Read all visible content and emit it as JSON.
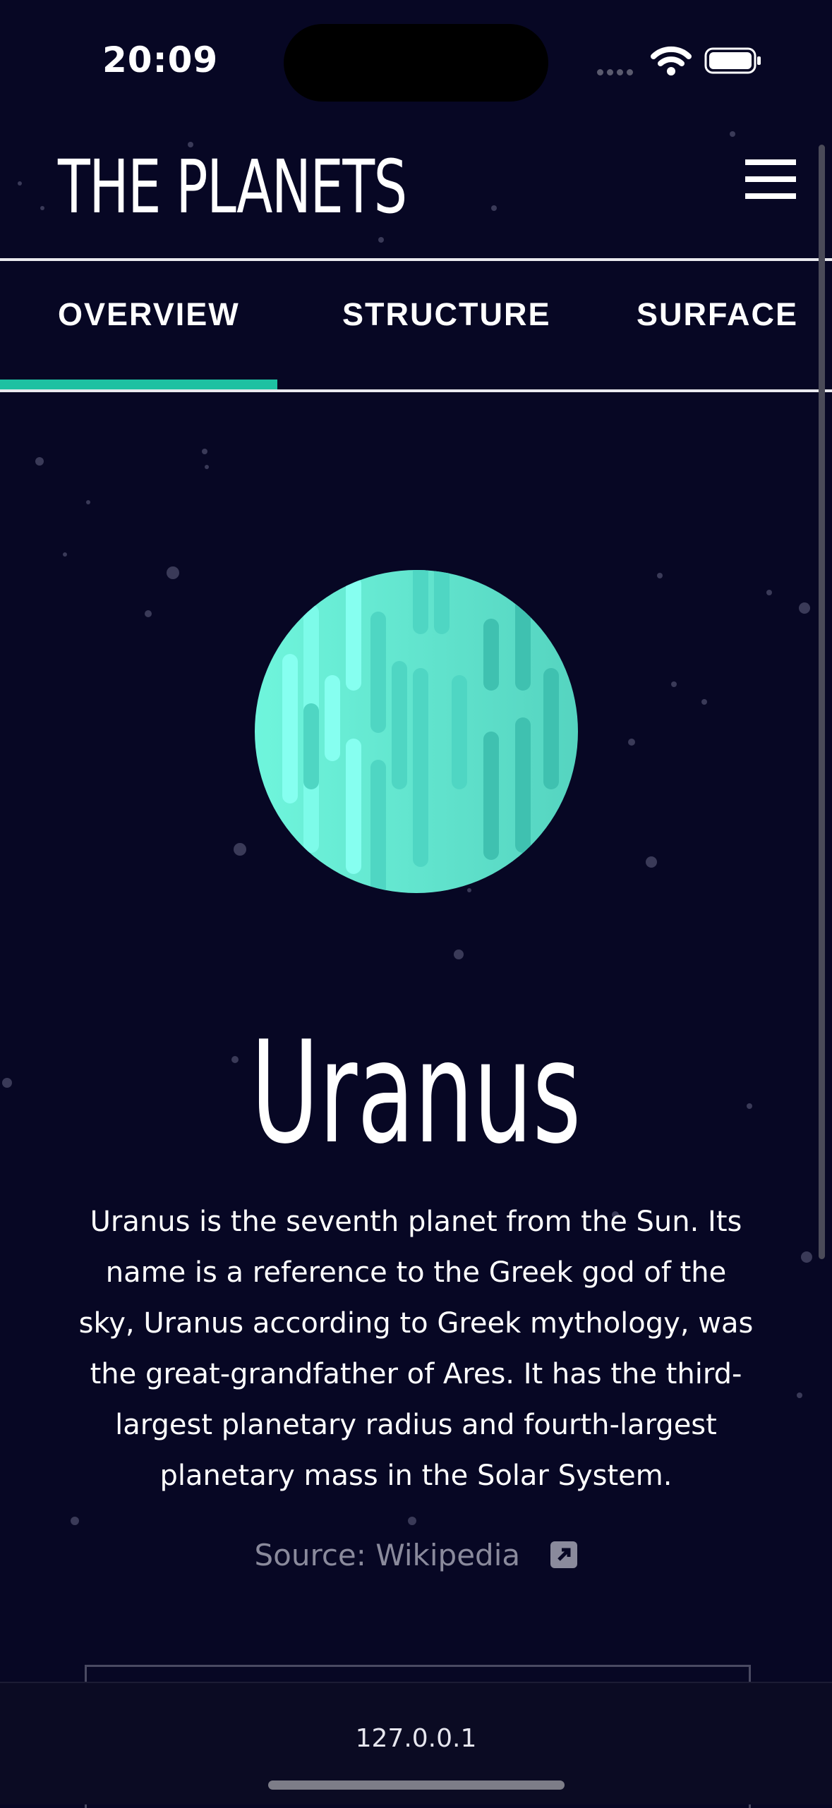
{
  "status_bar": {
    "time": "20:09"
  },
  "header": {
    "logo": "THE PLANETS"
  },
  "tabs": [
    {
      "label": "OVERVIEW",
      "active": true
    },
    {
      "label": "STRUCTURE",
      "active": false
    },
    {
      "label": "SURFACE",
      "active": false
    }
  ],
  "planet": {
    "name": "Uranus",
    "description": "Uranus is the seventh planet from the Sun. Its name is a reference to the Greek god of the sky, Uranus according to Greek mythology, was the great-grandfather of Ares. It has the third-largest planetary radius and fourth-largest planetary mass in the Solar System.",
    "source_label": "Source: Wikipedia"
  },
  "browser": {
    "url": "127.0.0.1"
  },
  "colors": {
    "background": "#070724",
    "accent": "#1ec1a2",
    "planet": "#65f0d5",
    "text": "#ffffff",
    "muted": "#8a8a9c"
  }
}
